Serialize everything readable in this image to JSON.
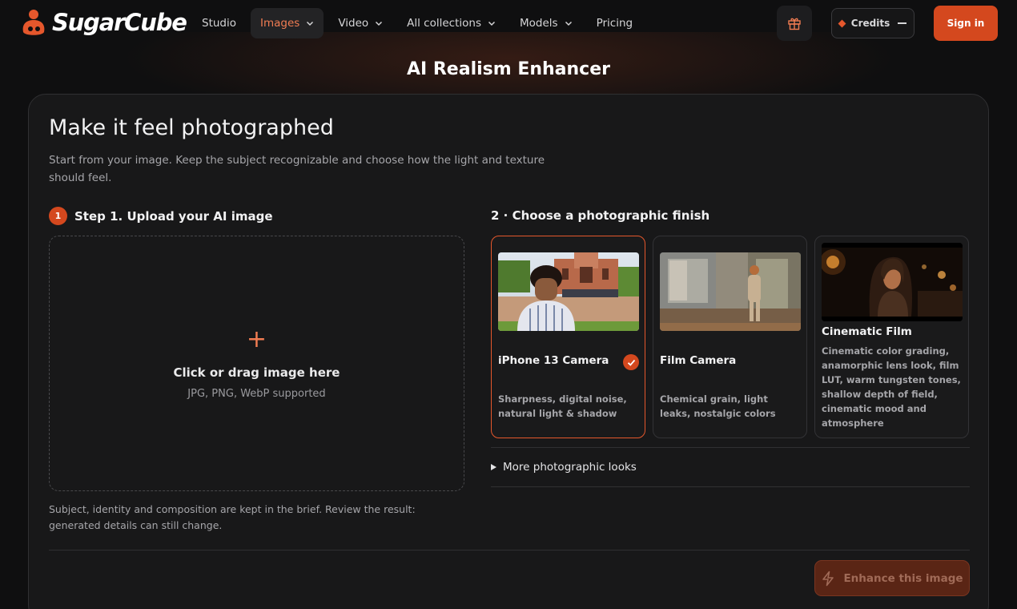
{
  "brand": {
    "name": "SugarCube",
    "accent": "#d4481e",
    "accent_light": "#f07c52"
  },
  "nav": {
    "links": [
      {
        "label": "Studio",
        "has_dropdown": false,
        "active": false
      },
      {
        "label": "Images",
        "has_dropdown": true,
        "active": true
      },
      {
        "label": "Video",
        "has_dropdown": true,
        "active": false
      },
      {
        "label": "All collections",
        "has_dropdown": true,
        "active": false
      },
      {
        "label": "Models",
        "has_dropdown": true,
        "active": false
      },
      {
        "label": "Pricing",
        "has_dropdown": false,
        "active": false
      }
    ],
    "gift_icon": "gift-icon",
    "credits_label": "Credits",
    "signin_label": "Sign in"
  },
  "page": {
    "title": "AI Realism Enhancer"
  },
  "panel": {
    "heading": "Make it feel photographed",
    "subtitle": "Start from your image. Keep the subject recognizable and choose how the light and texture should feel.",
    "step1": {
      "number": "1",
      "title": "Step 1. Upload your AI image",
      "dropzone_plus": "+",
      "dropzone_label": "Click or drag image here",
      "dropzone_formats": "JPG, PNG, WebP supported",
      "note": "Subject, identity and composition are kept in the brief. Review the result: generated details can still change."
    },
    "step2": {
      "title": "2 · Choose a photographic finish",
      "cards": [
        {
          "title": "iPhone 13 Camera",
          "description": "Sharpness, digital noise, natural light & shadow",
          "selected": true
        },
        {
          "title": "Film Camera",
          "description": "Chemical grain, light leaks, nostalgic colors",
          "selected": false
        },
        {
          "title": "Cinematic Film",
          "description": "Cinematic color grading, anamorphic lens look, film LUT, warm tungsten tones, shallow depth of field, cinematic mood and atmosphere",
          "selected": false
        }
      ],
      "more_looks": "More photographic looks"
    },
    "enhance_label": "Enhance this image"
  }
}
